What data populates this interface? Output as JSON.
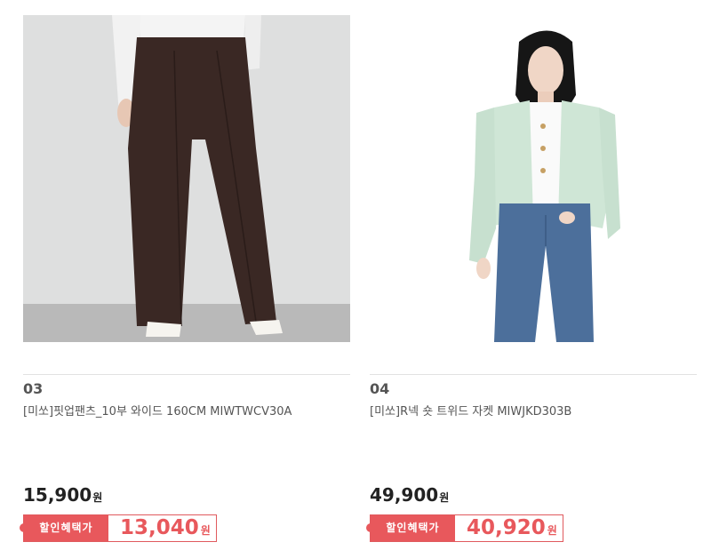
{
  "products": [
    {
      "number": "03",
      "name": "[미쏘]핏업팬츠_10부 와이드 160CM MIWTWCV30A",
      "price": "15,900",
      "price_unit": "원",
      "sale_label": "할인혜택가",
      "sale_price": "13,040",
      "sale_unit": "원",
      "image": "wide-pants-photo"
    },
    {
      "number": "04",
      "name": "[미쏘]R넥 숏 트위드 자켓 MIWJKD303B",
      "price": "49,900",
      "price_unit": "원",
      "sale_label": "할인혜택가",
      "sale_price": "40,920",
      "sale_unit": "원",
      "image": "tweed-jacket-photo"
    }
  ],
  "colors": {
    "sale_accent": "#e8585c",
    "divider": "#e2e2e2"
  }
}
